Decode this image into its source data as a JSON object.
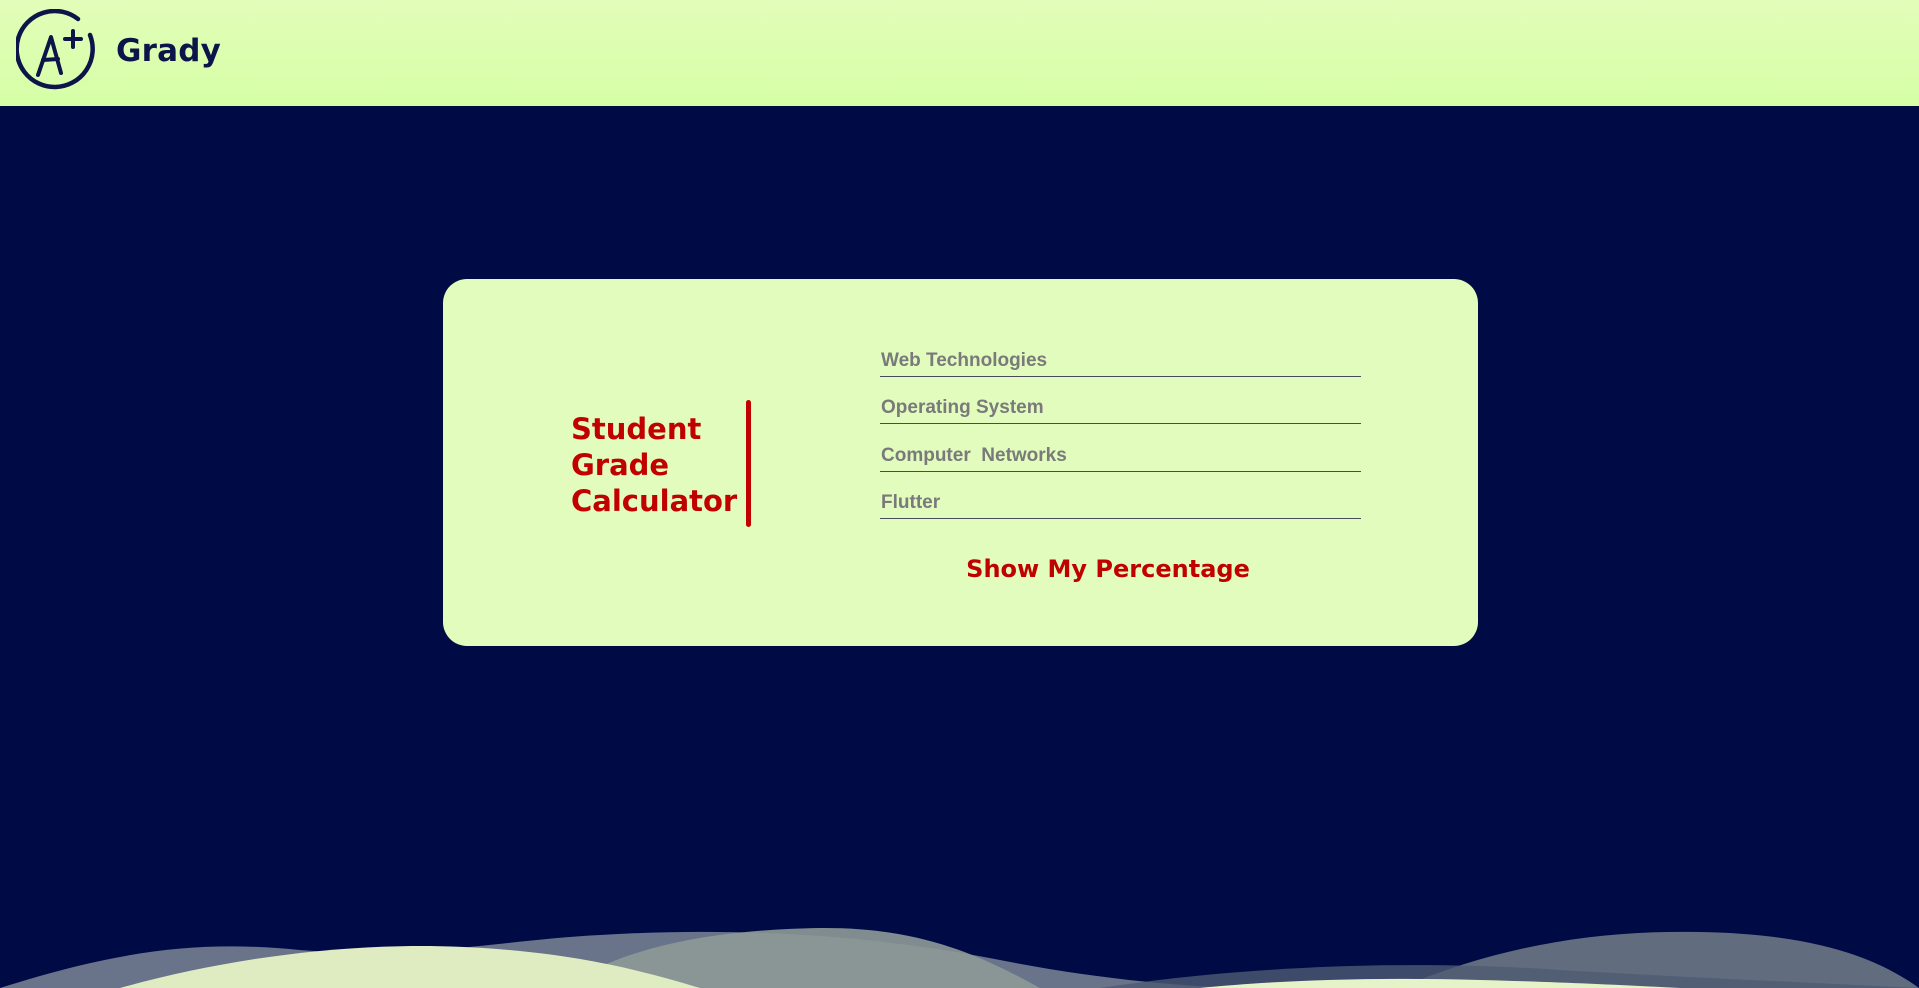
{
  "header": {
    "brand": "Grady",
    "logo_icon": "a-plus-grade-icon",
    "background": "#dcfdb0"
  },
  "card": {
    "title_lines": [
      "Student",
      "Grade",
      "Calculator"
    ],
    "fields": [
      {
        "placeholder": "Web Technologies",
        "value": ""
      },
      {
        "placeholder": "Operating System",
        "value": ""
      },
      {
        "placeholder": "Computer  Networks",
        "value": ""
      },
      {
        "placeholder": "Flutter",
        "value": ""
      }
    ],
    "submit_label": "Show My Percentage"
  },
  "colors": {
    "page_background": "#000a45",
    "card_background": "#e1fcbd",
    "accent": "#c10000",
    "brand_text": "#0d1449"
  }
}
